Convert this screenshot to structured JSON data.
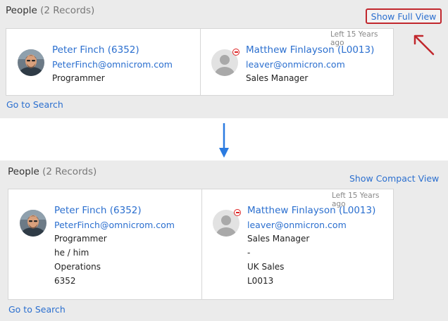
{
  "compact": {
    "title": "People",
    "count": "(2 Records)",
    "toggle_label": "Show Full View",
    "go_to_search": "Go to Search",
    "people": [
      {
        "name": "Peter Finch (6352)",
        "email": "PeterFinch@omnicrom.com",
        "role": "Programmer",
        "avatar": "user-photo"
      },
      {
        "name": "Matthew Finlayson (L0013)",
        "email": "leaver@onmicron.com",
        "role": "Sales Manager",
        "status_note": "Left 15 Years ago",
        "avatar": "default-user-silhouette"
      }
    ]
  },
  "full": {
    "title": "People",
    "count": "(2 Records)",
    "toggle_label": "Show Compact View",
    "go_to_search": "Go to Search",
    "people": [
      {
        "name": "Peter Finch (6352)",
        "email": "PeterFinch@omnicrom.com",
        "details": [
          "Programmer",
          "he / him",
          "Operations",
          "6352"
        ],
        "avatar": "user-photo"
      },
      {
        "name": "Matthew Finlayson (L0013)",
        "email": "leaver@onmicron.com",
        "details": [
          "Sales Manager",
          "-",
          "UK Sales",
          "L0013"
        ],
        "status_note": "Left 15 Years ago",
        "avatar": "default-user-silhouette"
      }
    ]
  },
  "colors": {
    "link": "#2b6fcf",
    "panel_bg": "#ebebeb",
    "highlight": "#c1272d",
    "arrow_red": "#c1272d",
    "arrow_blue": "#2b7be0"
  }
}
